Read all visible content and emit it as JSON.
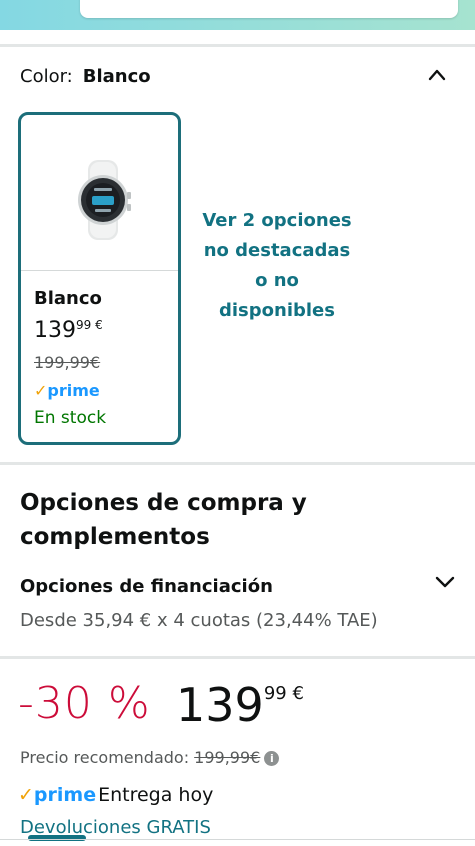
{
  "colors": {
    "accent": "#127282",
    "discount_red": "#cc0c39",
    "stock_green": "#007600",
    "prime_blue": "#1a98ff"
  },
  "color_selector": {
    "label": "Color:",
    "selected": "Blanco",
    "toggle_icon": "chevron-up-icon"
  },
  "swatch": {
    "name": "Blanco",
    "price_whole": "139",
    "price_fraction": "99 €",
    "old_price": "199,99€",
    "prime_check": "✓",
    "prime_label": "prime",
    "stock": "En stock"
  },
  "unavailable_options": "Ver 2 opciones no destacadas o no disponibles",
  "purchase_options": {
    "title": "Opciones de compra y complementos",
    "financing_title": "Opciones de financiación",
    "financing_detail": "Desde 35,94 € x 4 cuotas (23,44% TAE)",
    "toggle_icon": "chevron-down-icon"
  },
  "price_block": {
    "discount": "-30 %",
    "price_whole": "139",
    "price_fraction": "99 €",
    "recommended_label": "Precio recomendado:",
    "recommended_price": "199,99€",
    "info_icon": "i"
  },
  "delivery": {
    "prime_check": "✓",
    "prime_label": "prime",
    "text": "Entrega hoy",
    "returns": "Devoluciones GRATIS"
  }
}
